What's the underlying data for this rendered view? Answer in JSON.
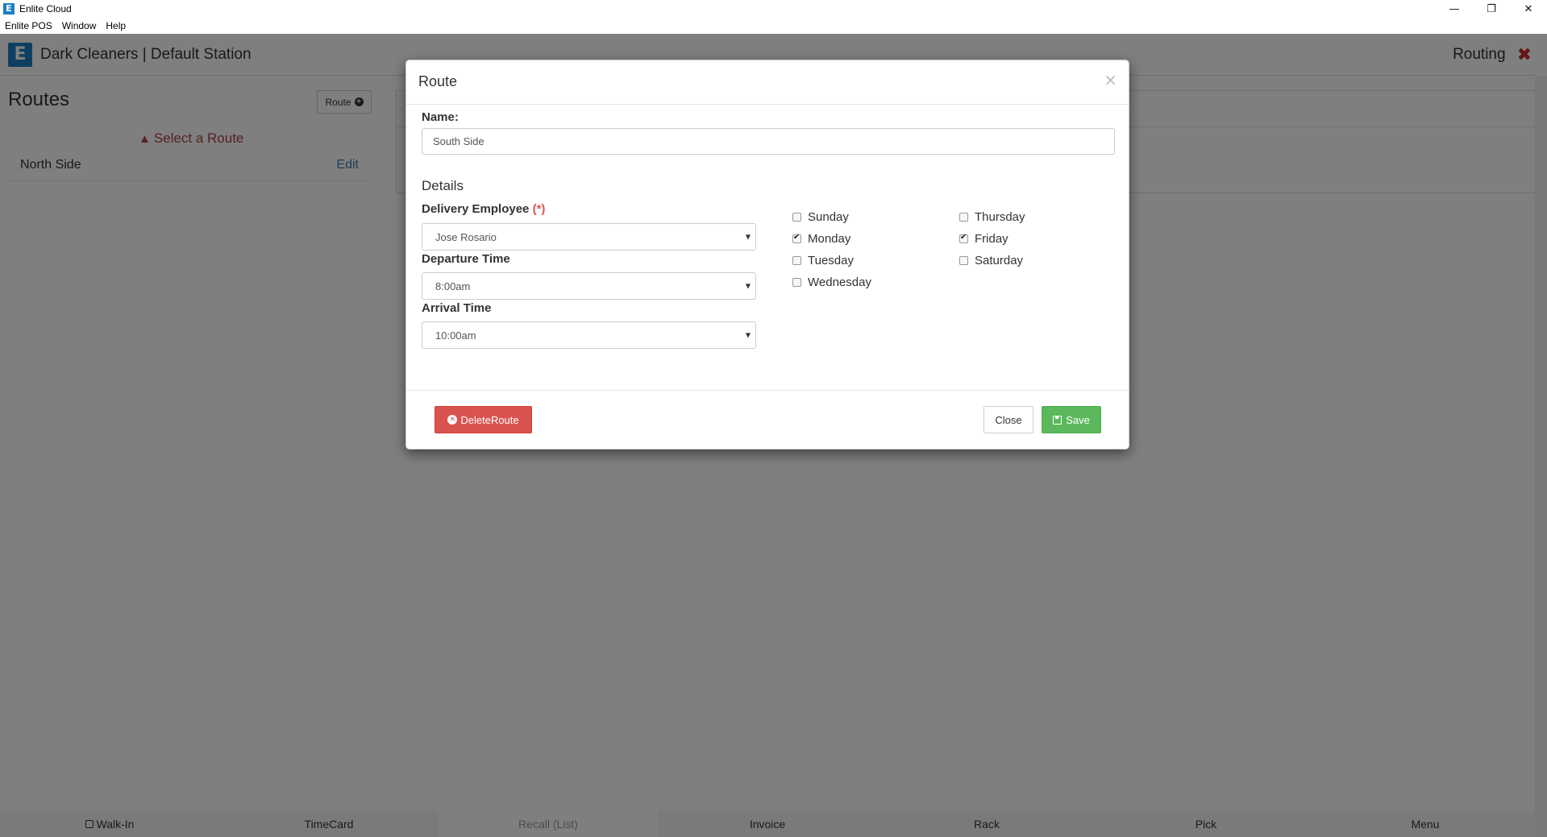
{
  "window": {
    "title": "Enlite Cloud",
    "icon_letter": "E",
    "minimize": "—",
    "restore": "❐",
    "close": "✕"
  },
  "menubar": [
    "Enlite POS",
    "Window",
    "Help"
  ],
  "header": {
    "brand": "Dark Cleaners | Default Station",
    "logo_letter": "E",
    "section": "Routing",
    "close_icon": "✖"
  },
  "routes": {
    "title": "Routes",
    "add_button": "Route",
    "warning": "Select a Route",
    "items": [
      {
        "name": "North Side",
        "action": "Edit"
      }
    ]
  },
  "modal": {
    "title": "Route",
    "close_icon": "×",
    "name_label": "Name:",
    "name_value": "South Side",
    "details_label": "Details",
    "employee_label": "Delivery Employee",
    "required_mark": "(*)",
    "employee_value": "Jose Rosario",
    "departure_label": "Departure Time",
    "departure_value": "8:00am",
    "arrival_label": "Arrival Time",
    "arrival_value": "10:00am",
    "days": [
      {
        "label": "Sunday",
        "checked": false
      },
      {
        "label": "Monday",
        "checked": true
      },
      {
        "label": "Tuesday",
        "checked": false
      },
      {
        "label": "Wednesday",
        "checked": false
      },
      {
        "label": "Thursday",
        "checked": false
      },
      {
        "label": "Friday",
        "checked": true
      },
      {
        "label": "Saturday",
        "checked": false
      }
    ],
    "delete_label": "DeleteRoute",
    "close_label": "Close",
    "save_label": "Save"
  },
  "bottom_nav": [
    "Walk-In",
    "TimeCard",
    "Recall (List)",
    "Invoice",
    "Rack",
    "Pick",
    "Menu"
  ],
  "colors": {
    "accent": "#1b7fc3",
    "danger": "#d9534f",
    "success": "#5cb85c",
    "link": "#337ab7"
  }
}
